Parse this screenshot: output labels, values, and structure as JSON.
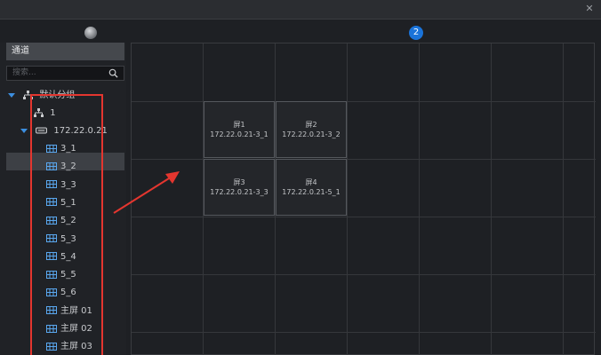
{
  "window": {
    "title": "",
    "close_glyph": "✕"
  },
  "page_badge": "2",
  "sidebar": {
    "header": "通道",
    "search_placeholder": "搜索...",
    "group": "默认分组",
    "group_child": "1",
    "device": "172.22.0.21",
    "channels": [
      "3_1",
      "3_2",
      "3_3",
      "5_1",
      "5_2",
      "5_3",
      "5_4",
      "5_5",
      "5_6",
      "主屏 01",
      "主屏 02",
      "主屏 03"
    ],
    "selected_channel": "5_1"
  },
  "screens": [
    {
      "name": "屏1",
      "source": "172.22.0.21-3_1"
    },
    {
      "name": "屏2",
      "source": "172.22.0.21-3_2"
    },
    {
      "name": "屏3",
      "source": "172.22.0.21-3_3"
    },
    {
      "name": "屏4",
      "source": "172.22.0.21-5_1"
    }
  ],
  "colors": {
    "accent": "#1a73d9",
    "highlight": "#e4362f",
    "tree_arrow": "#3c8fe0"
  }
}
